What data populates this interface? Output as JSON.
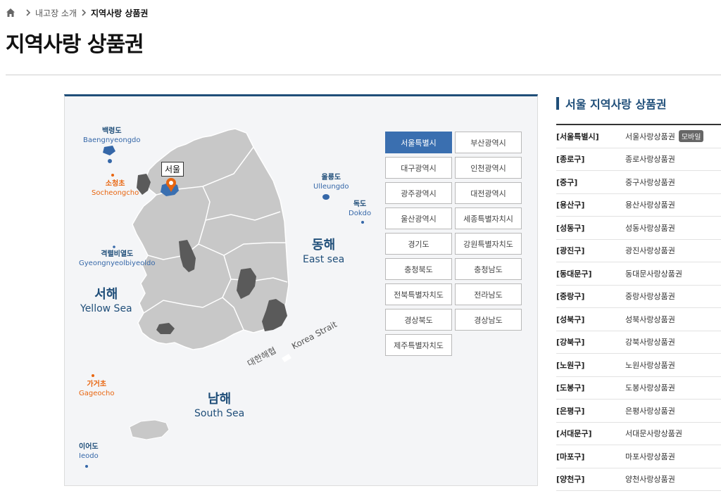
{
  "breadcrumb": {
    "items": [
      "내고장 소개",
      "지역사랑 상품권"
    ]
  },
  "page": {
    "title": "지역사랑 상품권"
  },
  "map": {
    "islands": [
      {
        "ko": "백령도",
        "en": "Baengnyeongdo"
      },
      {
        "ko": "소청초",
        "en": "Socheongcho"
      },
      {
        "ko": "울릉도",
        "en": "Ulleungdo"
      },
      {
        "ko": "독도",
        "en": "Dokdo"
      },
      {
        "ko": "격렬비열도",
        "en": "Gyeongnyeolbiyeoldo"
      },
      {
        "ko": "가거초",
        "en": "Gageocho"
      },
      {
        "ko": "이어도",
        "en": "Ieodo"
      }
    ],
    "seas": [
      {
        "ko": "동해",
        "en": "East sea"
      },
      {
        "ko": "서해",
        "en": "Yellow Sea"
      },
      {
        "ko": "남해",
        "en": "South Sea"
      }
    ],
    "strait": {
      "ko": "대한해협",
      "en": "Korea Strait"
    },
    "seoul_marker": "서울",
    "colors": {
      "land": "#c8c8c8",
      "highlight": "#5a5a5a",
      "seoul": "#3a6fb0",
      "marker": "#e8650f"
    }
  },
  "regions": [
    "서울특별시",
    "부산광역시",
    "대구광역시",
    "인천광역시",
    "광주광역시",
    "대전광역시",
    "울산광역시",
    "세종특별자치시",
    "경기도",
    "강원특별자치도",
    "충청북도",
    "충청남도",
    "전북특별자치도",
    "전라남도",
    "경상북도",
    "경상남도",
    "제주특별자치도"
  ],
  "active_region": "서울특별시",
  "side": {
    "title": "서울 지역사랑 상품권",
    "rows": [
      {
        "district": "[서울특별시]",
        "voucher": "서울사랑상품권",
        "badge": "모바일"
      },
      {
        "district": "[종로구]",
        "voucher": "종로사랑상품권"
      },
      {
        "district": "[중구]",
        "voucher": "중구사랑상품권"
      },
      {
        "district": "[용산구]",
        "voucher": "용산사랑상품권"
      },
      {
        "district": "[성동구]",
        "voucher": "성동사랑상품권"
      },
      {
        "district": "[광진구]",
        "voucher": "광진사랑상품권"
      },
      {
        "district": "[동대문구]",
        "voucher": "동대문사랑상품권"
      },
      {
        "district": "[중랑구]",
        "voucher": "중랑사랑상품권"
      },
      {
        "district": "[성북구]",
        "voucher": "성북사랑상품권"
      },
      {
        "district": "[강북구]",
        "voucher": "강북사랑상품권"
      },
      {
        "district": "[노원구]",
        "voucher": "노원사랑상품권"
      },
      {
        "district": "[도봉구]",
        "voucher": "도봉사랑상품권"
      },
      {
        "district": "[은평구]",
        "voucher": "은평사랑상품권"
      },
      {
        "district": "[서대문구]",
        "voucher": "서대문사랑상품권"
      },
      {
        "district": "[마포구]",
        "voucher": "마포사랑상품권"
      },
      {
        "district": "[양천구]",
        "voucher": "양천사랑상품권"
      }
    ]
  }
}
